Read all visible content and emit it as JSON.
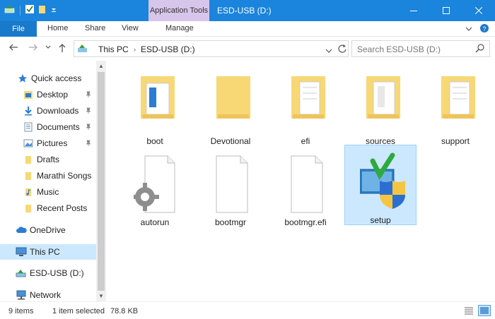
{
  "title_bar": {
    "context_tab": "Application Tools",
    "window_title": "ESD-USB (D:)"
  },
  "ribbon": {
    "tabs": [
      "File",
      "Home",
      "Share",
      "View",
      "Manage"
    ]
  },
  "address": {
    "crumbs": [
      "This PC",
      "ESD-USB (D:)"
    ],
    "search_placeholder": "Search ESD-USB (D:)"
  },
  "nav": {
    "items": [
      {
        "label": "Quick access",
        "icon": "star-icon"
      },
      {
        "label": "Desktop",
        "icon": "desktop-folder-icon",
        "pinned": true
      },
      {
        "label": "Downloads",
        "icon": "downloads-folder-icon",
        "pinned": true
      },
      {
        "label": "Documents",
        "icon": "documents-folder-icon",
        "pinned": true
      },
      {
        "label": "Pictures",
        "icon": "pictures-folder-icon",
        "pinned": true
      },
      {
        "label": "Drafts",
        "icon": "folder-icon"
      },
      {
        "label": "Marathi Songs",
        "icon": "folder-icon"
      },
      {
        "label": "Music",
        "icon": "music-folder-icon"
      },
      {
        "label": "Recent Posts",
        "icon": "folder-icon"
      },
      {
        "label": "OneDrive",
        "icon": "cloud-icon"
      },
      {
        "label": "This PC",
        "icon": "computer-icon",
        "selected": true
      },
      {
        "label": "ESD-USB (D:)",
        "icon": "usb-drive-icon"
      },
      {
        "label": "Network",
        "icon": "network-icon"
      }
    ]
  },
  "files": [
    {
      "name": "boot",
      "type": "folder",
      "selected": false
    },
    {
      "name": "Devotional",
      "type": "folder",
      "selected": false
    },
    {
      "name": "efi",
      "type": "folder",
      "selected": false
    },
    {
      "name": "sources",
      "type": "folder",
      "selected": false
    },
    {
      "name": "support",
      "type": "folder",
      "selected": false
    },
    {
      "name": "autorun",
      "type": "settings-file",
      "selected": false
    },
    {
      "name": "bootmgr",
      "type": "file",
      "selected": false
    },
    {
      "name": "bootmgr.efi",
      "type": "file",
      "selected": false
    },
    {
      "name": "setup",
      "type": "setup-app",
      "selected": true
    }
  ],
  "status": {
    "item_count": "9 items",
    "selection": "1 item selected",
    "size": "78.8 KB"
  },
  "colors": {
    "title_bar": "#1b84dc",
    "file_tab": "#1979ca",
    "context_tab": "#d8c5ec",
    "selection": "#cce8ff",
    "folder": "#f8d775"
  }
}
